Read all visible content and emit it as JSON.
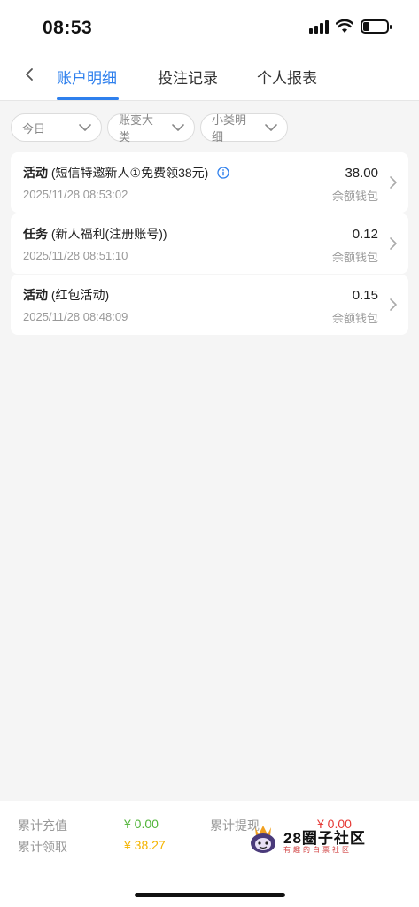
{
  "status_bar": {
    "time": "08:53",
    "battery_level": 0.25
  },
  "nav": {
    "tabs": [
      {
        "label": "账户明细",
        "active": true
      },
      {
        "label": "投注记录",
        "active": false
      },
      {
        "label": "个人报表",
        "active": false
      }
    ]
  },
  "filters": [
    {
      "label": "今日"
    },
    {
      "label": "账变大类"
    },
    {
      "label": "小类明细"
    }
  ],
  "records": [
    {
      "category": "活动",
      "detail": " (短信特邀新人①免费领38元)",
      "has_info": true,
      "time": "2025/11/28 08:53:02",
      "amount": "38.00",
      "wallet": "余额钱包"
    },
    {
      "category": "任务",
      "detail": " (新人福利(注册账号))",
      "has_info": false,
      "time": "2025/11/28 08:51:10",
      "amount": "0.12",
      "wallet": "余额钱包"
    },
    {
      "category": "活动",
      "detail": " (红包活动)",
      "has_info": false,
      "time": "2025/11/28 08:48:09",
      "amount": "0.15",
      "wallet": "余额钱包"
    }
  ],
  "summary": {
    "recharge_label": "累计充值",
    "recharge_value": "¥ 0.00",
    "withdraw_label": "累计提现",
    "withdraw_value": "¥ 0.00",
    "claim_label": "累计领取",
    "claim_value": "¥ 38.27"
  },
  "watermark": {
    "title": "28圈子社区",
    "subtitle": "有趣的白票社区"
  },
  "colors": {
    "accent": "#2f80ed",
    "green": "#52b53a",
    "yellow": "#f4b400",
    "red": "#e53935"
  }
}
